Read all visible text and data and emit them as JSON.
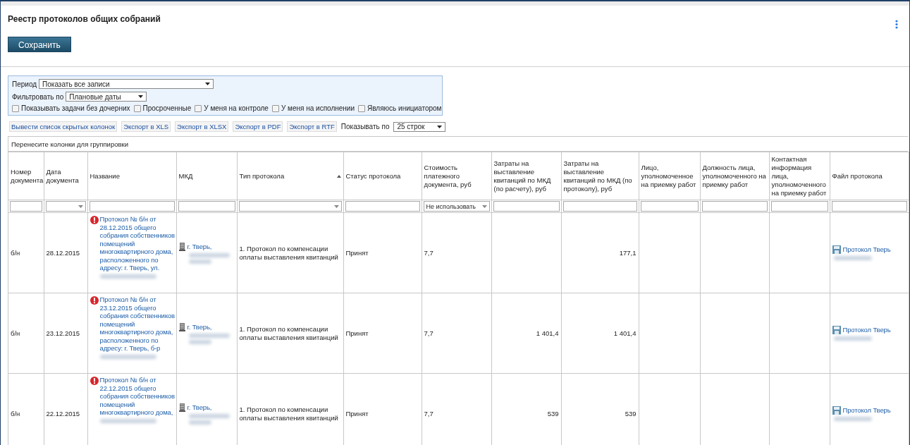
{
  "header": {
    "title": "Реестр протоколов общих собраний",
    "save_button": "Сохранить"
  },
  "filters": {
    "period_label": "Период",
    "period_value": "Показать все записи",
    "filter_by_label": "Фильтровать по",
    "filter_by_value": "Плановые даты",
    "checkboxes": [
      {
        "label": "Показывать задачи без дочерних",
        "checked": false
      },
      {
        "label": "Просроченные",
        "checked": false
      },
      {
        "label": "У меня на контроле",
        "checked": false
      },
      {
        "label": "У меня на исполнении",
        "checked": false
      },
      {
        "label": "Являюсь инициатором",
        "checked": false
      }
    ]
  },
  "toolbar": {
    "buttons": [
      "Вывести список скрытых колонок",
      "Экспорт в XLS",
      "Экспорт в XLSX",
      "Экспорт в PDF",
      "Экспорт в RTF"
    ],
    "page_size_label": "Показывать по",
    "page_size_value": "25 строк"
  },
  "table": {
    "group_hint": "Перенесите колонки для группировки",
    "columns": [
      {
        "label": "Номер документа",
        "sorted": false,
        "kind": "text",
        "filter": {
          "kind": "text"
        }
      },
      {
        "label": "Дата документа",
        "sorted": false,
        "kind": "text",
        "filter": {
          "kind": "select"
        }
      },
      {
        "label": "Название",
        "sorted": false,
        "kind": "title",
        "filter": {
          "kind": "text"
        }
      },
      {
        "label": "МКД",
        "sorted": false,
        "kind": "address",
        "filter": {
          "kind": "text"
        }
      },
      {
        "label": "Тип протокола",
        "sorted": true,
        "kind": "text",
        "filter": {
          "kind": "select"
        }
      },
      {
        "label": "Статус протокола",
        "sorted": false,
        "kind": "text",
        "filter": {
          "kind": "text"
        }
      },
      {
        "label": "Стоимость платежного документа, руб",
        "sorted": false,
        "kind": "text",
        "filter": {
          "kind": "select",
          "value": "Не использовать"
        }
      },
      {
        "label": "Затраты на выставление квитанций по МКД (по расчету), руб",
        "sorted": false,
        "kind": "number",
        "filter": {
          "kind": "text"
        }
      },
      {
        "label": "Затраты на выставление квитанций по МКД (по протоколу), руб",
        "sorted": false,
        "kind": "number",
        "filter": {
          "kind": "text"
        }
      },
      {
        "label": "Лицо, уполномоченное на приемку работ",
        "sorted": false,
        "kind": "text",
        "filter": {
          "kind": "text"
        }
      },
      {
        "label": "Должность лица, уполномоченного на приемку работ",
        "sorted": false,
        "kind": "text",
        "filter": {
          "kind": "text"
        }
      },
      {
        "label": "Контактная информация лица, уполномоченного на приемку работ",
        "sorted": false,
        "kind": "text",
        "filter": {
          "kind": "text"
        }
      },
      {
        "label": "Файл протокола",
        "sorted": false,
        "kind": "file",
        "filter": {
          "kind": "text"
        }
      }
    ],
    "rows": [
      {
        "warning": true,
        "cells": [
          "б/н",
          "28.12.2015",
          "Протокол № б/н от 28.12.2015 общего собрания собственников помещений многоквартирного дома, расположенного по адресу: г. Тверь, ул.",
          "г. Тверь,",
          "1. Протокол по компенсации оплаты выставления квитанций",
          "Принят",
          "7,7",
          null,
          "177,1",
          null,
          null,
          null,
          "Протокол Тверь"
        ]
      },
      {
        "warning": true,
        "cells": [
          "б/н",
          "23.12.2015",
          "Протокол № б/н от 23.12.2015 общего собрания собственников помещений многоквартирного дома, расположенного по адресу: г. Тверь, б-р",
          "г. Тверь,",
          "1. Протокол по компенсации оплаты выставления квитанций",
          "Принят",
          "7,7",
          "1 401,4",
          "1 401,4",
          null,
          null,
          null,
          "Протокол Тверь"
        ]
      },
      {
        "warning": true,
        "cells": [
          "б/н",
          "22.12.2015",
          "Протокол № б/н от 22.12.2015 общего собрания собственников помещений многоквартирного дома,",
          "г. Тверь,",
          "1. Протокол по компенсации оплаты выставления квитанций",
          "Принят",
          "7,7",
          "539",
          "539",
          null,
          null,
          null,
          "Протокол Тверь"
        ]
      }
    ]
  }
}
